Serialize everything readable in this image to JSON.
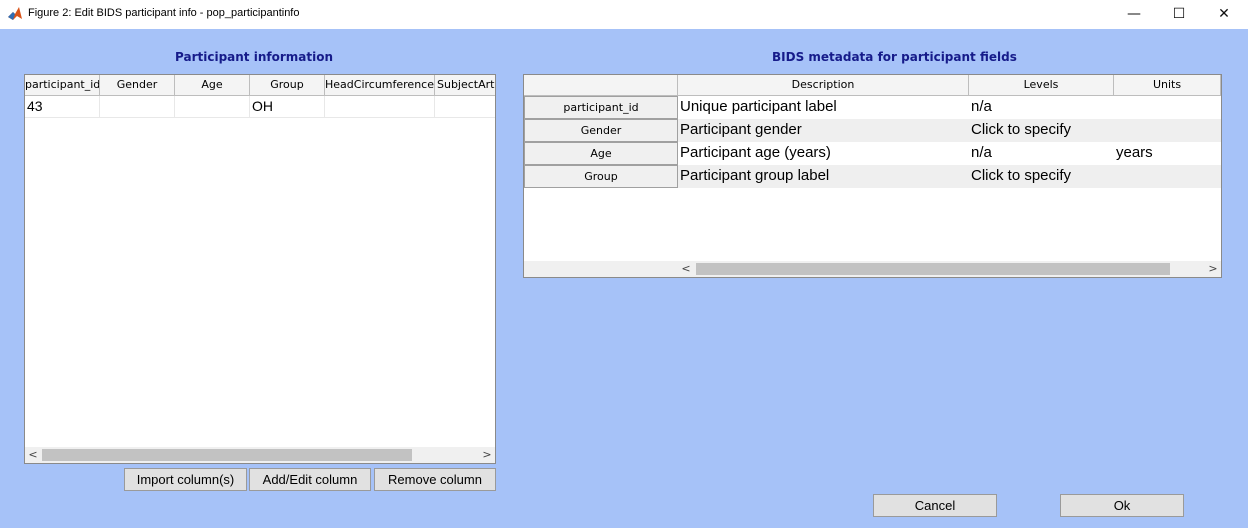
{
  "window": {
    "title": "Figure 2: Edit BIDS participant info - pop_participantinfo",
    "minimize": "—",
    "maximize": "☐",
    "close": "✕"
  },
  "left_panel": {
    "title": "Participant information",
    "columns": [
      "participant_id",
      "Gender",
      "Age",
      "Group",
      "HeadCircumference",
      "SubjectArte"
    ],
    "rows": [
      [
        "43",
        "",
        "",
        "OH",
        "",
        ""
      ]
    ],
    "scroll_left": "<",
    "scroll_right": ">"
  },
  "buttons": {
    "import": "Import column(s)",
    "add_edit": "Add/Edit column",
    "remove": "Remove column",
    "cancel": "Cancel",
    "ok": "Ok"
  },
  "right_panel": {
    "title": "BIDS metadata for participant fields",
    "columns": [
      "Description",
      "Levels",
      "Units"
    ],
    "rows": [
      {
        "field": "participant_id",
        "description": "Unique participant label",
        "levels": "n/a",
        "units": ""
      },
      {
        "field": "Gender",
        "description": "Participant gender",
        "levels": "Click to specify",
        "units": ""
      },
      {
        "field": "Age",
        "description": "Participant age (years)",
        "levels": "n/a",
        "units": "years"
      },
      {
        "field": "Group",
        "description": "Participant group label",
        "levels": "Click to specify",
        "units": ""
      }
    ],
    "scroll_left": "<",
    "scroll_right": ">"
  },
  "colors": {
    "figure_background": "#a6c2f8",
    "panel_title": "#161b8a"
  }
}
